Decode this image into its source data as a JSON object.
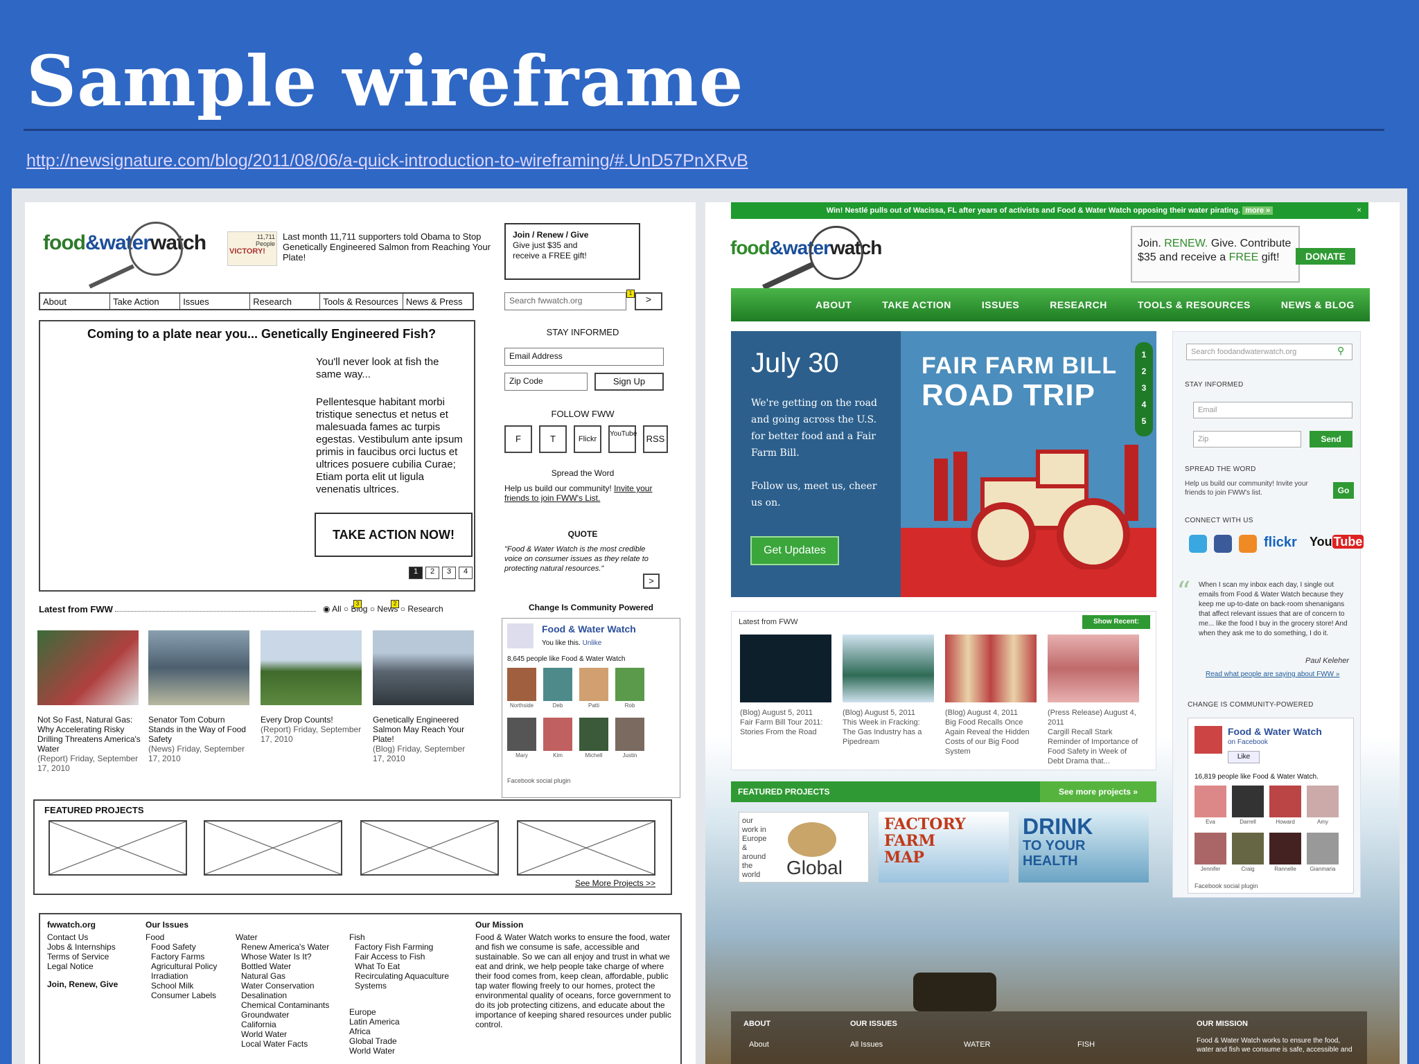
{
  "slide": {
    "title": "Sample wireframe",
    "link": "http://newsignature.com/blog/2011/08/06/a-quick-introduction-to-wireframing/#.UnD57PnXRvB"
  },
  "wireframe": {
    "logo": {
      "a": "food",
      "amp": "&",
      "b": "water",
      "c": "watch"
    },
    "badge": {
      "number": "11,711",
      "sub": "People",
      "victory": "VICTORY!"
    },
    "promo": "Last month 11,711 supporters told Obama to Stop Genetically Engineered Salmon from Reaching Your Plate!",
    "join": {
      "title": "Join / Renew / Give",
      "text": "Give just $35 and receive a FREE gift!"
    },
    "nav": [
      "About",
      "Take Action",
      "Issues",
      "Research",
      "Tools & Resources",
      "News & Press"
    ],
    "search": {
      "placeholder": "Search fwwatch.org",
      "go": ">",
      "badge": "1"
    },
    "headline": "Coming to a plate near you... Genetically Engineered Fish?",
    "body1": "You'll never look at fish the same way...",
    "body2": "Pellentesque habitant morbi tristique senectus et netus et malesuada fames ac turpis egestas. Vestibulum ante ipsum primis in faucibus orci luctus et ultrices posuere cubilia Curae; Etiam porta elit ut ligula venenatis ultrices.",
    "cta": "TAKE ACTION NOW!",
    "pages": [
      "1",
      "2",
      "3",
      "4"
    ],
    "stay": {
      "heading": "STAY INFORMED",
      "email": "Email Address",
      "zip": "Zip Code",
      "signup": "Sign Up"
    },
    "follow": {
      "heading": "FOLLOW FWW",
      "items": [
        "F",
        "T",
        "Flickr",
        "YouTube",
        "RSS"
      ]
    },
    "spread": {
      "heading": "Spread the Word",
      "text": "Help us build our community!",
      "link": "Invite your friends to join FWW's List."
    },
    "quote": {
      "heading": "QUOTE",
      "text": "\"Food & Water Watch is the most credible voice on consumer issues as they relate to protecting natural resources.\"",
      "go": ">"
    },
    "latest": {
      "heading": "Latest from FWW",
      "filters": [
        "All",
        "Blog",
        "News",
        "Research"
      ],
      "badges": [
        "3",
        "2"
      ]
    },
    "articles": [
      {
        "title": "Not So Fast, Natural Gas: Why Accelerating Risky Drilling Threatens America's Water",
        "meta": "(Report) Friday, September 17, 2010"
      },
      {
        "title": "Senator Tom Coburn Stands in the Way of Food Safety",
        "meta": "(News) Friday, September 17, 2010"
      },
      {
        "title": "Every Drop Counts!",
        "meta": "(Report) Friday, September 17, 2010"
      },
      {
        "title": "Genetically Engineered Salmon May Reach Your Plate!",
        "meta": "(Blog) Friday, September 17, 2010"
      }
    ],
    "community": {
      "heading": "Change Is Community Powered",
      "page": "Food & Water Watch",
      "like": "You like this.",
      "unlike": "Unlike",
      "count": "8,645 people like Food & Water Watch",
      "people": [
        "Northside",
        "Deb",
        "Patti",
        "Rob",
        "Mary",
        "Kim",
        "Michell",
        "Justin"
      ],
      "plugin": "Facebook social plugin"
    },
    "featured": {
      "heading": "FEATURED PROJECTS",
      "more": "See More Projects >>"
    },
    "footer": {
      "site": "fwwatch.org",
      "links": [
        "Contact Us",
        "Jobs & Internships",
        "Terms of Service",
        "Legal Notice"
      ],
      "join": "Join, Renew, Give",
      "issues_heading": "Our Issues",
      "food": [
        "Food",
        "Food Safety",
        "Factory Farms",
        "Agricultural Policy",
        "Irradiation",
        "School Milk",
        "Consumer Labels"
      ],
      "water": [
        "Water",
        "Renew America's Water",
        "Whose Water Is It?",
        "Bottled Water",
        "Natural Gas",
        "Water Conservation",
        "Desalination",
        "Chemical Contaminants",
        "Groundwater",
        "California",
        "World Water",
        "Local Water Facts"
      ],
      "fish": [
        "Fish",
        "Factory Fish Farming",
        "Fair Access to Fish",
        "What To Eat",
        "Recirculating Aquaculture Systems"
      ],
      "regions": [
        "Europe",
        "Latin America",
        "Africa",
        "Global Trade",
        "World Water"
      ],
      "mission_heading": "Our Mission",
      "mission": "Food & Water Watch works to ensure the food, water and fish we consume is safe, accessible and sustainable. So we can all enjoy and trust in what we eat and drink, we help people take charge of where their food comes from, keep clean, affordable, public tap water flowing freely to our homes, protect the environmental quality of oceans, force government to do its job protecting citizens, and educate about the importance of keeping shared resources under public control."
    }
  },
  "mockup": {
    "topbar": "Win! Nestlé pulls out of Wacissa, FL after years of activists and Food & Water Watch opposing their water pirating.",
    "topbar_more": "more »",
    "topbar_close": "×",
    "join": {
      "a": "Join.",
      "renew": "RENEW.",
      "b": "Give. Contribute $35 and receive a",
      "free": "FREE",
      "c": "gift!"
    },
    "donate": "DONATE",
    "nav": [
      "ABOUT",
      "TAKE ACTION",
      "ISSUES",
      "RESEARCH",
      "TOOLS & RESOURCES",
      "NEWS & BLOG"
    ],
    "hero": {
      "date": "July 30",
      "text1": "We're getting on the road and going across the U.S. for better food and a Fair Farm Bill.",
      "text2": "Follow us, meet us, cheer us on.",
      "button": "Get Updates",
      "title1": "FAIR FARM BILL",
      "title2": "ROAD TRIP",
      "nums": [
        "1",
        "2",
        "3",
        "4",
        "5"
      ]
    },
    "search": "Search foodandwaterwatch.org",
    "stay": {
      "heading": "STAY INFORMED",
      "email": "Email",
      "zip": "Zip",
      "send": "Send"
    },
    "spread": {
      "heading": "SPREAD THE WORD",
      "text": "Help us build our community! Invite your friends to join FWW's list.",
      "go": "Go"
    },
    "connect": {
      "heading": "CONNECT WITH US",
      "flickr": "flickr",
      "you": "You",
      "tube": "Tube"
    },
    "quote": {
      "text": "When I scan my inbox each day, I single out emails from Food & Water Watch because they keep me up-to-date on back-room shenanigans that affect relevant issues that are of concern to me... like the food I buy in the grocery store! And when they ask me to do something, I do it.",
      "author": "Paul Keleher",
      "link": "Read what people are saying about FWW »"
    },
    "latest": {
      "heading": "Latest from FWW",
      "show": "Show Recent:"
    },
    "posts": [
      {
        "meta": "(Blog) August 5, 2011",
        "title": "Fair Farm Bill Tour 2011: Stories From the Road"
      },
      {
        "meta": "(Blog) August 5, 2011",
        "title": "This Week in Fracking: The Gas Industry has a Pipedream"
      },
      {
        "meta": "(Blog) August 4, 2011",
        "title": "Big Food Recalls Once Again Reveal the Hidden Costs of our Big Food System"
      },
      {
        "meta": "(Press Release) August 4, 2011",
        "title": "Cargill Recall Stark Reminder of Importance of Food Safety in Week of Debt Drama that..."
      }
    ],
    "featured": {
      "heading": "FEATURED PROJECTS",
      "more": "See more projects »",
      "p1_side": "our work in Europe & around the world",
      "p1": "Global",
      "p2a": "FACTORY",
      "p2b": "FARM",
      "p2c": "MAP",
      "p3a": "DRINK",
      "p3b": "TO YOUR",
      "p3c": "HEALTH"
    },
    "community": {
      "heading": "CHANGE IS COMMUNITY-POWERED",
      "page": "Food & Water Watch",
      "on": "on Facebook",
      "like": "Like",
      "count": "16,819 people like Food & Water Watch.",
      "people": [
        "Eva",
        "Darrell",
        "Howard",
        "Amy",
        "Jennifer",
        "Craig",
        "Rannelle",
        "Gianmaria"
      ],
      "plugin": "Facebook social plugin"
    },
    "footer": {
      "about": "ABOUT",
      "issues": "OUR ISSUES",
      "mission": "OUR MISSION",
      "c1": "About",
      "c2": "All Issues",
      "c3": "WATER",
      "c4": "FISH",
      "mission_text": "Food & Water Watch works to ensure the food, water and fish we consume is safe, accessible and"
    }
  }
}
